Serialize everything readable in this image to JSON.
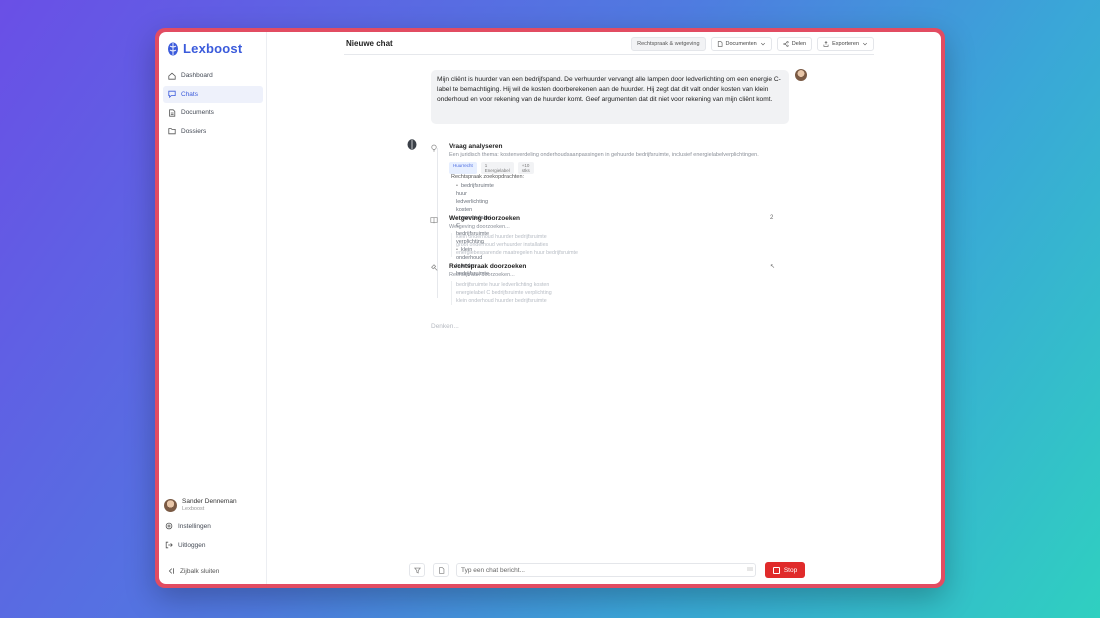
{
  "app": {
    "logo": "Lexboost",
    "brand_color": "#3b5bdb",
    "frame_color": "#e24c62"
  },
  "sidebar": {
    "items": [
      {
        "label": "Dashboard",
        "icon": "home-icon"
      },
      {
        "label": "Chats",
        "icon": "chat-icon",
        "active": true
      },
      {
        "label": "Documents",
        "icon": "document-icon"
      },
      {
        "label": "Dossiers",
        "icon": "folder-icon"
      }
    ],
    "user": {
      "name": "Sander Denneman",
      "org": "Lexboost"
    },
    "settings_label": "Instellingen",
    "logout_label": "Uitloggen",
    "collapse_label": "Zijbalk sluiten"
  },
  "header": {
    "title": "Nieuwe chat",
    "mode_label": "Rechtspraak & wetgeving",
    "documents_label": "Documenten",
    "share_label": "Delen",
    "export_label": "Exporteren"
  },
  "user_message": {
    "text": "Mijn cliënt is huurder van een bedrijfspand. De verhuurder vervangt alle lampen door ledverlichting om een energie C-label te bemachtiging. Hij wil de kosten doorberekenen aan de huurder. Hij zegt dat dit valt onder kosten van klein onderhoud en voor rekening van de huurder komt. Geef argumenten dat dit niet voor rekening van mijn cliënt komt."
  },
  "steps": [
    {
      "title": "Vraag analyseren",
      "subtitle": "Een juridisch thema: kostenverdeling onderhoudsaanpassingen in gehuurde bedrijfsruimte, inclusief energielabelverplichtingen.",
      "tags": [
        "Huurrecht",
        "1 Energielabel",
        "+10 stks"
      ],
      "subhead": "Rechtspraak zoekopdrachten:",
      "bullets": [
        "bedrijfsruimte huur ledverlichting kosten",
        "energielabel C bedrijfsruimte verplichting",
        "klein onderhoud huurder bedrijfsruimte"
      ]
    },
    {
      "title": "Wetgeving doorzoeken",
      "subtitle": "Wetgeving doorzoeken...",
      "faded": [
        "klein onderhoud huurder bedrijfsruimte",
        "groot onderhoud verhuurder installaties",
        "energiebesparende maatregelen huur bedrijfsruimte"
      ],
      "right": "2"
    },
    {
      "title": "Rechtspraak doorzoeken",
      "subtitle": "Rechtspraak doorzoeken...",
      "faded": [
        "bedrijfsruimte huur ledverlichting kosten",
        "energielabel C bedrijfsruimte verplichting",
        "klein onderhoud huurder bedrijfsruimte"
      ],
      "right": "↖"
    }
  ],
  "thinking_label": "Denken...",
  "composer": {
    "placeholder": "Typ een chat bericht...",
    "stop_label": "Stop",
    "stop_color": "#e02b2b"
  }
}
